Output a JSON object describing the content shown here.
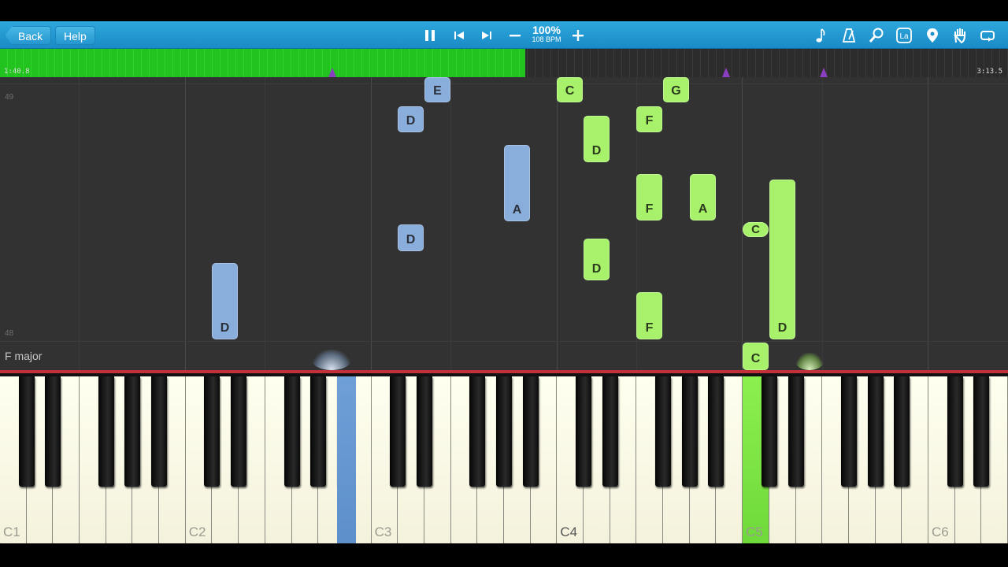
{
  "toolbar": {
    "back_label": "Back",
    "help_label": "Help",
    "speed_percent": "100%",
    "speed_bpm": "108 BPM",
    "icons": [
      "pause-icon",
      "skip-back-icon",
      "skip-forward-icon",
      "minus-icon",
      "plus-icon",
      "music-note-icon",
      "metronome-icon",
      "zoom-icon",
      "key-label-icon",
      "location-pin-icon",
      "hand-icon",
      "loop-icon"
    ],
    "key_label_glyph": "La"
  },
  "timeline": {
    "current_time": "1:40.8",
    "total_time": "3:13.5",
    "progress_fraction": 0.521,
    "marker_fractions": [
      0.33,
      0.72,
      0.817
    ],
    "progress_color": "#22c21f",
    "marker_color": "#8a3fc0"
  },
  "roll": {
    "measure_top": "49",
    "measure_bottom": "48",
    "key_signature": "F major"
  },
  "notes": [
    {
      "label": "E",
      "hand": "left"
    },
    {
      "label": "D",
      "hand": "left"
    },
    {
      "label": "A",
      "hand": "left"
    },
    {
      "label": "D",
      "hand": "left"
    },
    {
      "label": "D",
      "hand": "left"
    },
    {
      "label": "C",
      "hand": "right"
    },
    {
      "label": "D",
      "hand": "right"
    },
    {
      "label": "D",
      "hand": "right"
    },
    {
      "label": "G",
      "hand": "right"
    },
    {
      "label": "F",
      "hand": "right"
    },
    {
      "label": "F",
      "hand": "right"
    },
    {
      "label": "F",
      "hand": "right"
    },
    {
      "label": "A",
      "hand": "right"
    },
    {
      "label": "C",
      "hand": "right"
    },
    {
      "label": "D",
      "hand": "right"
    },
    {
      "label": "C",
      "hand": "right"
    }
  ],
  "keyboard": {
    "octave_labels": [
      "C1",
      "C2",
      "C3",
      "C4",
      "C5",
      "C6"
    ],
    "left_hand_color": "#6f9fd6",
    "right_hand_color": "#8cf04f"
  }
}
